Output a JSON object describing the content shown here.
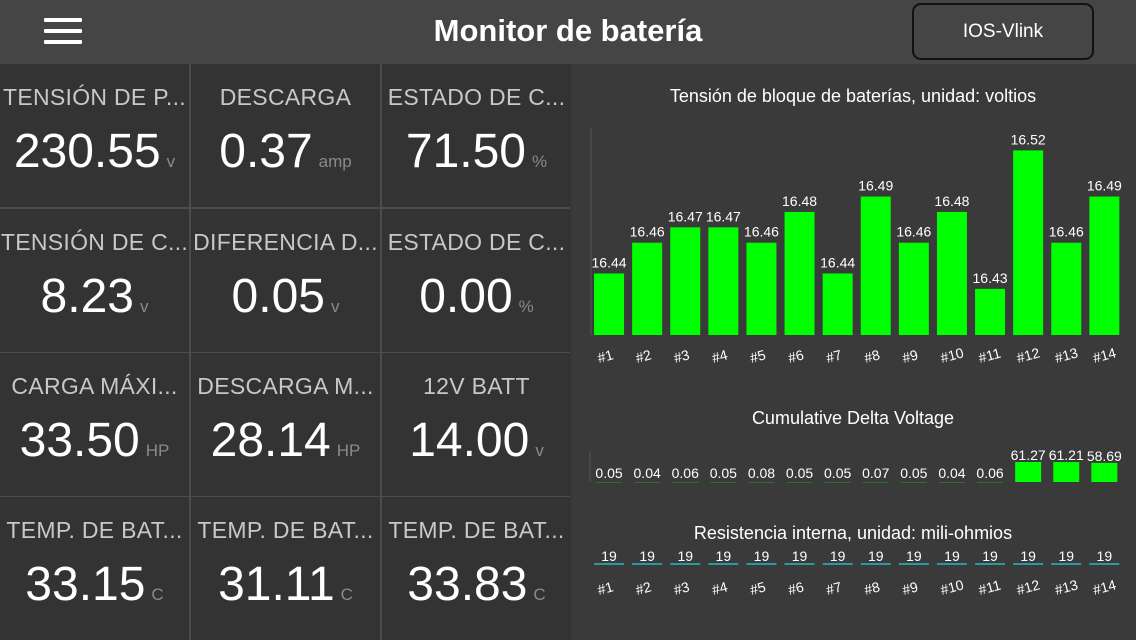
{
  "header": {
    "title": "Monitor de batería",
    "device_button": "IOS-Vlink"
  },
  "tiles": [
    {
      "label": "TENSIÓN DE P...",
      "value": "230.55",
      "unit": "v"
    },
    {
      "label": "DESCARGA",
      "value": "0.37",
      "unit": "amp"
    },
    {
      "label": "ESTADO DE C...",
      "value": "71.50",
      "unit": "%"
    },
    {
      "label": "TENSIÓN DE C...",
      "value": "8.23",
      "unit": "v"
    },
    {
      "label": "DIFERENCIA D...",
      "value": "0.05",
      "unit": "v"
    },
    {
      "label": "ESTADO DE C...",
      "value": "0.00",
      "unit": "%"
    },
    {
      "label": "CARGA MÁXI...",
      "value": "33.50",
      "unit": "HP"
    },
    {
      "label": "DESCARGA M...",
      "value": "28.14",
      "unit": "HP"
    },
    {
      "label": "12V BATT",
      "value": "14.00",
      "unit": "v"
    },
    {
      "label": "TEMP. DE BAT...",
      "value": "33.15",
      "unit": "C"
    },
    {
      "label": "TEMP. DE BAT...",
      "value": "31.11",
      "unit": "C"
    },
    {
      "label": "TEMP. DE BAT...",
      "value": "33.83",
      "unit": "C"
    }
  ],
  "colors": {
    "bar": "#00ff00",
    "resistance_line": "#29b6c4",
    "background": "#3a3a3a",
    "tile": "#333333"
  },
  "chart_data": [
    {
      "type": "bar",
      "title": "Tensión de bloque de baterías, unidad: voltios",
      "categories": [
        "#1",
        "#2",
        "#3",
        "#4",
        "#5",
        "#6",
        "#7",
        "#8",
        "#9",
        "#10",
        "#11",
        "#12",
        "#13",
        "#14"
      ],
      "values": [
        16.44,
        16.46,
        16.47,
        16.47,
        16.46,
        16.48,
        16.44,
        16.49,
        16.46,
        16.48,
        16.43,
        16.52,
        16.46,
        16.49
      ],
      "value_labels": [
        "16.44",
        "16.46",
        "16.47",
        "16.47",
        "16.46",
        "16.48",
        "16.44",
        "16.49",
        "16.46",
        "16.48",
        "16.43",
        "16.52",
        "16.46",
        "16.49"
      ],
      "ylim": [
        16.4,
        16.53
      ]
    },
    {
      "type": "bar",
      "title": "Cumulative Delta Voltage",
      "categories": [
        "#1",
        "#2",
        "#3",
        "#4",
        "#5",
        "#6",
        "#7",
        "#8",
        "#9",
        "#10",
        "#11",
        "#12",
        "#13",
        "#14"
      ],
      "values": [
        0.05,
        0.04,
        0.06,
        0.05,
        0.08,
        0.05,
        0.05,
        0.07,
        0.05,
        0.04,
        0.06,
        61.27,
        61.21,
        58.69
      ],
      "value_labels": [
        "0.05",
        "0.04",
        "0.06",
        "0.05",
        "0.08",
        "0.05",
        "0.05",
        "0.07",
        "0.05",
        "0.04",
        "0.06",
        "61.27",
        "61.21",
        "58.69"
      ]
    },
    {
      "type": "bar",
      "title": "Resistencia interna, unidad: mili-ohmios",
      "categories": [
        "#1",
        "#2",
        "#3",
        "#4",
        "#5",
        "#6",
        "#7",
        "#8",
        "#9",
        "#10",
        "#11",
        "#12",
        "#13",
        "#14"
      ],
      "values": [
        19,
        19,
        19,
        19,
        19,
        19,
        19,
        19,
        19,
        19,
        19,
        19,
        19,
        19
      ],
      "value_labels": [
        "19",
        "19",
        "19",
        "19",
        "19",
        "19",
        "19",
        "19",
        "19",
        "19",
        "19",
        "19",
        "19",
        "19"
      ]
    }
  ]
}
